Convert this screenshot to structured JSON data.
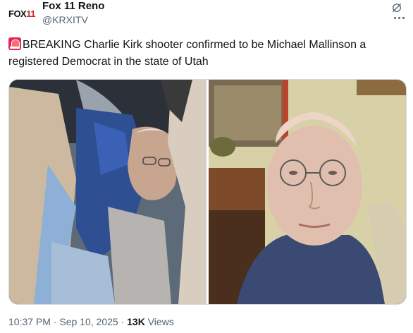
{
  "account": {
    "logo_text": "FOX",
    "logo_number": "11",
    "name": "Fox 11 Reno",
    "handle": "@KRXITV"
  },
  "tweet": {
    "text": "BREAKING Charlie Kirk shooter confirmed to be Michael Mallinson a registered Democrat in the state of Utah"
  },
  "footer": {
    "time": "10:37 PM",
    "separator1": " · ",
    "date": "Sep 10, 2025",
    "separator2": " · ",
    "views_count": "13K",
    "views_label": " Views"
  },
  "icons": {
    "grok": "grok-icon",
    "more": "more-icon",
    "siren": "siren-icon"
  },
  "colors": {
    "text": "#0f1419",
    "secondary": "#536471",
    "border": "#cfd9de",
    "brand_red": "#d4202a"
  }
}
